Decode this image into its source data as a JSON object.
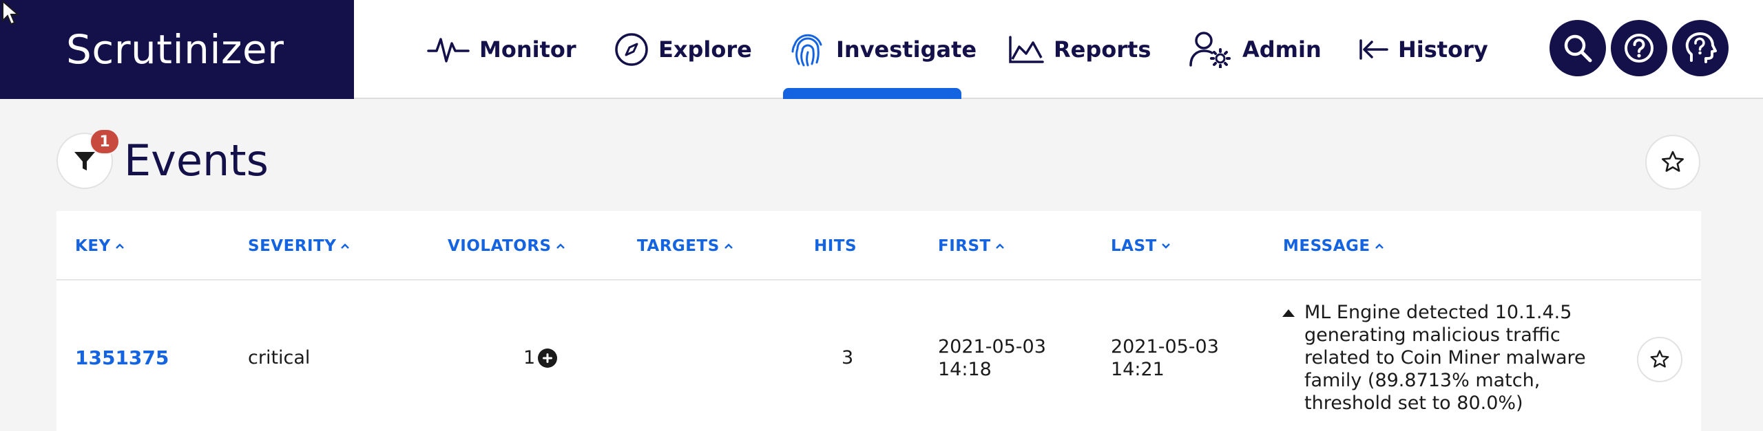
{
  "app": {
    "brand": "Scrutinizer"
  },
  "nav": {
    "items": [
      {
        "label": "Monitor",
        "icon": "pulse-icon"
      },
      {
        "label": "Explore",
        "icon": "compass-icon"
      },
      {
        "label": "Investigate",
        "icon": "fingerprint-icon",
        "active": true
      },
      {
        "label": "Reports",
        "icon": "area-chart-icon"
      },
      {
        "label": "Admin",
        "icon": "user-gear-icon"
      },
      {
        "label": "History",
        "icon": "arrow-left-icon"
      }
    ],
    "actions": [
      "search-icon",
      "help-icon",
      "support-icon"
    ]
  },
  "page": {
    "title": "Events",
    "filter_badge": "1"
  },
  "table": {
    "columns": [
      {
        "label": "KEY",
        "sort": "asc"
      },
      {
        "label": "SEVERITY",
        "sort": "asc"
      },
      {
        "label": "VIOLATORS",
        "sort": "asc"
      },
      {
        "label": "TARGETS",
        "sort": "asc"
      },
      {
        "label": "HITS",
        "sort": ""
      },
      {
        "label": "FIRST",
        "sort": "asc"
      },
      {
        "label": "LAST",
        "sort": "desc"
      },
      {
        "label": "MESSAGE",
        "sort": "asc"
      }
    ],
    "rows": [
      {
        "key": "1351375",
        "severity": "critical",
        "violators": "1",
        "targets": "",
        "hits": "3",
        "first_date": "2021-05-03",
        "first_time": "14:18",
        "last_date": "2021-05-03",
        "last_time": "14:21",
        "message": "ML Engine detected 10.1.4.5 generating malicious traffic related to Coin Miner malware family (89.8713% match, threshold set to 80.0%)"
      }
    ]
  },
  "colors": {
    "brand_bg": "#14104a",
    "accent": "#1463e0",
    "badge": "#c8493d"
  }
}
